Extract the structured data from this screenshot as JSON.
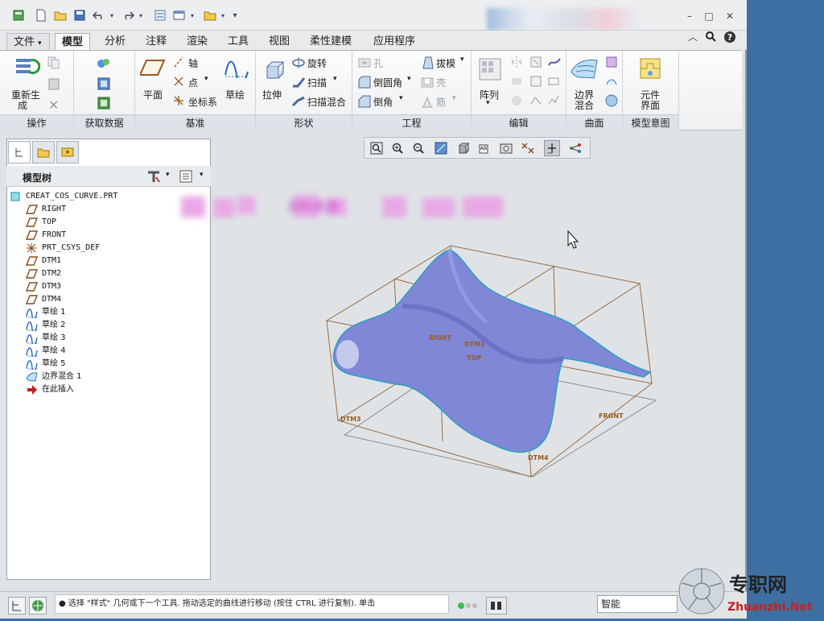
{
  "quick_access": {
    "icons": [
      "window-icon",
      "new-icon",
      "open-icon",
      "save-icon",
      "undo-icon",
      "redo-icon",
      "regenerate-icon",
      "switch-window-icon",
      "folder-icon",
      "customize-icon"
    ]
  },
  "window_controls": {
    "minimize": "–",
    "restore": "□",
    "close": "✕"
  },
  "ribbon_tabs": [
    "文件",
    "模型",
    "分析",
    "注释",
    "渲染",
    "工具",
    "视图",
    "柔性建模",
    "应用程序"
  ],
  "ribbon_file_arrow": "▾",
  "active_tab": "模型",
  "ribbon": {
    "operations": {
      "regenerate_label_1": "重新生",
      "regenerate_label_2": "成",
      "group": "操作"
    },
    "get_data": {
      "group": "获取数据"
    },
    "datum": {
      "plane": "平面",
      "axis": "轴",
      "point": "点",
      "csys": "坐标系",
      "sketch": "草绘",
      "group": "基准"
    },
    "shapes": {
      "extrude": "拉伸",
      "revolve": "旋转",
      "sweep": "扫描",
      "swept_blend": "扫描混合",
      "group": "形状"
    },
    "engineering": {
      "hole": "孔",
      "draft": "拔模",
      "round": "倒圆角",
      "shell": "壳",
      "chamfer": "倒角",
      "rib": "筋",
      "group": "工程"
    },
    "editing": {
      "pattern": "阵列",
      "group": "编辑"
    },
    "surfaces": {
      "boundary_1": "边界",
      "boundary_2": "混合",
      "group": "曲面"
    },
    "model_intent": {
      "component_1": "元件",
      "component_2": "界面",
      "group": "模型意图"
    }
  },
  "model_tree": {
    "title": "模型树",
    "items": [
      {
        "label": "CREAT_COS_CURVE.PRT",
        "icon": "part-icon"
      },
      {
        "label": "RIGHT",
        "icon": "datum-plane-icon"
      },
      {
        "label": "TOP",
        "icon": "datum-plane-icon"
      },
      {
        "label": "FRONT",
        "icon": "datum-plane-icon"
      },
      {
        "label": "PRT_CSYS_DEF",
        "icon": "csys-icon"
      },
      {
        "label": "DTM1",
        "icon": "datum-plane-icon"
      },
      {
        "label": "DTM2",
        "icon": "datum-plane-icon"
      },
      {
        "label": "DTM3",
        "icon": "datum-plane-icon"
      },
      {
        "label": "DTM4",
        "icon": "datum-plane-icon"
      },
      {
        "label": "草绘 1",
        "icon": "sketch-icon"
      },
      {
        "label": "草绘 2",
        "icon": "sketch-icon"
      },
      {
        "label": "草绘 3",
        "icon": "sketch-icon"
      },
      {
        "label": "草绘 4",
        "icon": "sketch-icon"
      },
      {
        "label": "草绘 5",
        "icon": "sketch-icon"
      },
      {
        "label": "边界混合 1",
        "icon": "boundary-blend-icon"
      },
      {
        "label": "在此插入",
        "icon": "insert-here-icon"
      }
    ]
  },
  "view_toolbar": {
    "icons": [
      "refit-icon",
      "zoom-in-icon",
      "zoom-out-icon",
      "repaint-icon",
      "display-style-icon",
      "saved-views-icon",
      "view-manager-icon",
      "datum-display-icon",
      "spin-center-icon",
      "annotation-display-icon"
    ]
  },
  "graphics": {
    "blurred_text": "资料来源",
    "datum_labels": [
      "RIGHT",
      "DTM1",
      "TOP",
      "DTM3",
      "FRONT",
      "DTM4"
    ],
    "surface_color": "#7f87d6"
  },
  "status": {
    "message": "● 选择 \"样式\" 几何或下一个工具. 拖动选定的曲线进行移动 (按住 CTRL 进行复制). 单击",
    "filter": "智能"
  },
  "watermark": {
    "text_cn": "专职网",
    "text_en": "Zhuanzhi.Net"
  }
}
